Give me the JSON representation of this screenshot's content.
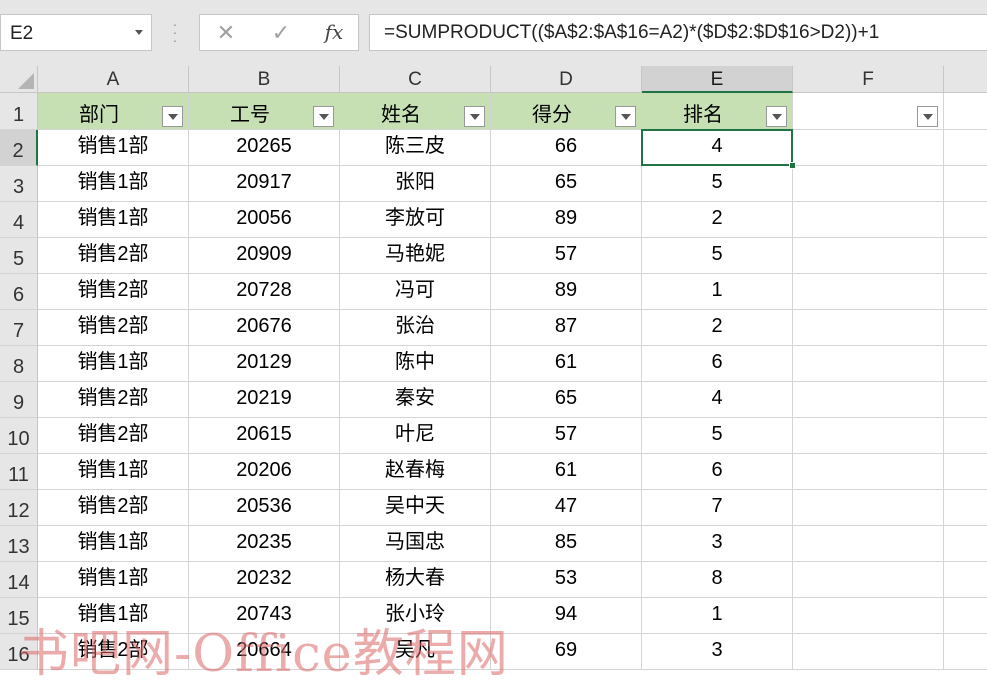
{
  "formula_bar": {
    "name_box": "E2",
    "cancel_icon": "✕",
    "enter_icon": "✓",
    "fx_label": "fx",
    "formula": "=SUMPRODUCT(($A$2:$A$16=A2)*($D$2:$D$16>D2))+1"
  },
  "columns": [
    "A",
    "B",
    "C",
    "D",
    "E",
    "F"
  ],
  "selected_cell": "E2",
  "headers": [
    "部门",
    "工号",
    "姓名",
    "得分",
    "排名",
    ""
  ],
  "rows": [
    {
      "num": "1"
    },
    {
      "num": "2",
      "cells": [
        "销售1部",
        "20265",
        "陈三皮",
        "66",
        "4"
      ]
    },
    {
      "num": "3",
      "cells": [
        "销售1部",
        "20917",
        "张阳",
        "65",
        "5"
      ]
    },
    {
      "num": "4",
      "cells": [
        "销售1部",
        "20056",
        "李放可",
        "89",
        "2"
      ]
    },
    {
      "num": "5",
      "cells": [
        "销售2部",
        "20909",
        "马艳妮",
        "57",
        "5"
      ]
    },
    {
      "num": "6",
      "cells": [
        "销售2部",
        "20728",
        "冯可",
        "89",
        "1"
      ]
    },
    {
      "num": "7",
      "cells": [
        "销售2部",
        "20676",
        "张治",
        "87",
        "2"
      ]
    },
    {
      "num": "8",
      "cells": [
        "销售1部",
        "20129",
        "陈中",
        "61",
        "6"
      ]
    },
    {
      "num": "9",
      "cells": [
        "销售2部",
        "20219",
        "秦安",
        "65",
        "4"
      ]
    },
    {
      "num": "10",
      "cells": [
        "销售2部",
        "20615",
        "叶尼",
        "57",
        "5"
      ]
    },
    {
      "num": "11",
      "cells": [
        "销售1部",
        "20206",
        "赵春梅",
        "61",
        "6"
      ]
    },
    {
      "num": "12",
      "cells": [
        "销售2部",
        "20536",
        "吴中天",
        "47",
        "7"
      ]
    },
    {
      "num": "13",
      "cells": [
        "销售1部",
        "20235",
        "马国忠",
        "85",
        "3"
      ]
    },
    {
      "num": "14",
      "cells": [
        "销售1部",
        "20232",
        "杨大春",
        "53",
        "8"
      ]
    },
    {
      "num": "15",
      "cells": [
        "销售1部",
        "20743",
        "张小玲",
        "94",
        "1"
      ]
    },
    {
      "num": "16",
      "cells": [
        "销售2部",
        "20664",
        "吴凡",
        "69",
        "3"
      ]
    }
  ],
  "watermark": "书吧网-Office教程网",
  "colors": {
    "header_fill": "#c6e0b4",
    "selection": "#217346",
    "watermark": "#dd6666"
  }
}
